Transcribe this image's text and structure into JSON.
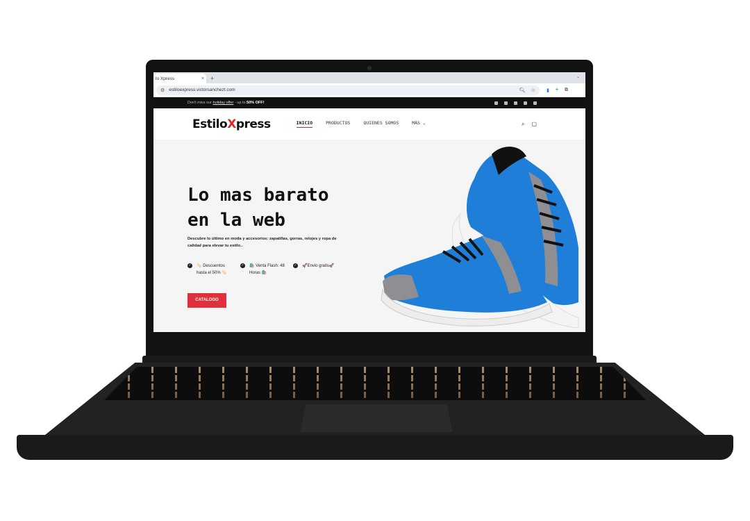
{
  "browser": {
    "tab_title": "lo Xpress",
    "tab_close": "×",
    "new_tab": "+",
    "url": "estiloexpress.victorsanchezt.com"
  },
  "topbar": {
    "prefix": "Don't miss our ",
    "offer_link": "holiday offer",
    "suffix": " - up to ",
    "discount": "50% OFF!"
  },
  "site": {
    "logo_before": "Estilo",
    "logo_x": "X",
    "logo_after": "press"
  },
  "nav": {
    "items": [
      "INICIO",
      "PRODUCTOS",
      "QUIENES SOMOS",
      "MÁS ⌄"
    ]
  },
  "hero": {
    "title_line1": "Lo mas barato",
    "title_line2": "en la web",
    "description": "Descubre lo último en moda y accesorios: zapatillas, gorras, relojes y ropa de calidad para elevar tu estilo..",
    "features": [
      "🏷️ Descuentos hasta el 50% 🏷️",
      "🛍️ Venta Flash: 48 Horas 🛍️",
      "🚀Envio gratis🚀"
    ],
    "cta": "CATALOGO"
  },
  "colors": {
    "accent": "#e0303c",
    "shoe_blue": "#1f7fd8",
    "topbar_bg": "#111111"
  },
  "icons": [
    "lock-icon",
    "search-icon",
    "star-icon",
    "extension-icon",
    "cart-icon",
    "facebook-icon",
    "instagram-icon",
    "twitter-icon",
    "mail-icon",
    "whatsapp-icon"
  ]
}
